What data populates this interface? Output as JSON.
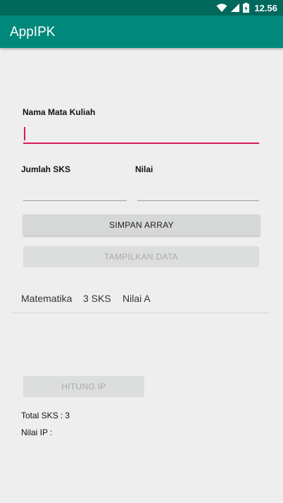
{
  "status_bar": {
    "time": "12.56",
    "icons": [
      "wifi-icon",
      "signal-icon",
      "battery-icon"
    ]
  },
  "app_bar": {
    "title": "AppIPK"
  },
  "form": {
    "course_name_label": "Nama Mata Kuliah",
    "course_name_value": "",
    "sks_label": "Jumlah SKS",
    "sks_value": "",
    "grade_label": "Nilai",
    "grade_value": ""
  },
  "buttons": {
    "save_array": "SIMPAN ARRAY",
    "show_data": "TAMPILKAN DATA",
    "calculate_ip": "HITUNG IP"
  },
  "list": [
    {
      "course": "Matematika",
      "sks": "3 SKS",
      "grade": "Nilai A"
    }
  ],
  "results": {
    "total_sks_label": "Total SKS :",
    "total_sks_value": "3",
    "ip_label": "Nilai IP :",
    "ip_value": ""
  },
  "colors": {
    "status_bar": "#00695C",
    "app_bar": "#00897B",
    "accent": "#D81B60",
    "background": "#EEEEEE"
  }
}
